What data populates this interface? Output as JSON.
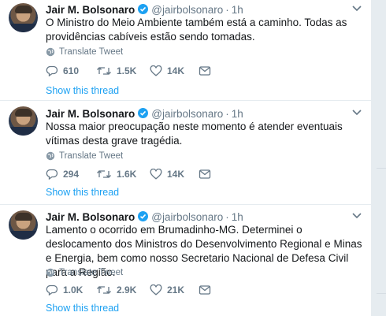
{
  "tweets": [
    {
      "name": "Jair M. Bolsonaro",
      "handle": "@jairbolsonaro",
      "time": "1h",
      "text": "O Ministro do Meio Ambiente também está a caminho. Todas as providências cabíveis estão sendo tomadas.",
      "translate": "Translate Tweet",
      "replies": "610",
      "retweets": "1.5K",
      "likes": "14K",
      "show_thread": "Show this thread"
    },
    {
      "name": "Jair M. Bolsonaro",
      "handle": "@jairbolsonaro",
      "time": "1h",
      "text": "Nossa maior preocupação neste momento é atender eventuais vítimas desta grave tragédia.",
      "translate": "Translate Tweet",
      "replies": "294",
      "retweets": "1.6K",
      "likes": "14K",
      "show_thread": "Show this thread"
    },
    {
      "name": "Jair M. Bolsonaro",
      "handle": "@jairbolsonaro",
      "time": "1h",
      "text": "Lamento o ocorrido em Brumadinho-MG. Determinei o deslocamento dos Ministros do Desenvolvimento Regional e Minas e Energia, bem como nosso Secretario Nacional de Defesa Civil para a Região.",
      "translate": "Translate Tweet",
      "replies": "1.0K",
      "retweets": "2.9K",
      "likes": "21K",
      "show_thread": "Show this thread"
    }
  ],
  "colors": {
    "accent": "#1da1f2",
    "muted": "#657786",
    "text": "#14171a",
    "background": "#e6ecf0"
  },
  "icons": [
    "verified-badge-icon",
    "chevron-down-icon",
    "globe-icon",
    "reply-icon",
    "retweet-icon",
    "like-icon",
    "message-icon"
  ]
}
